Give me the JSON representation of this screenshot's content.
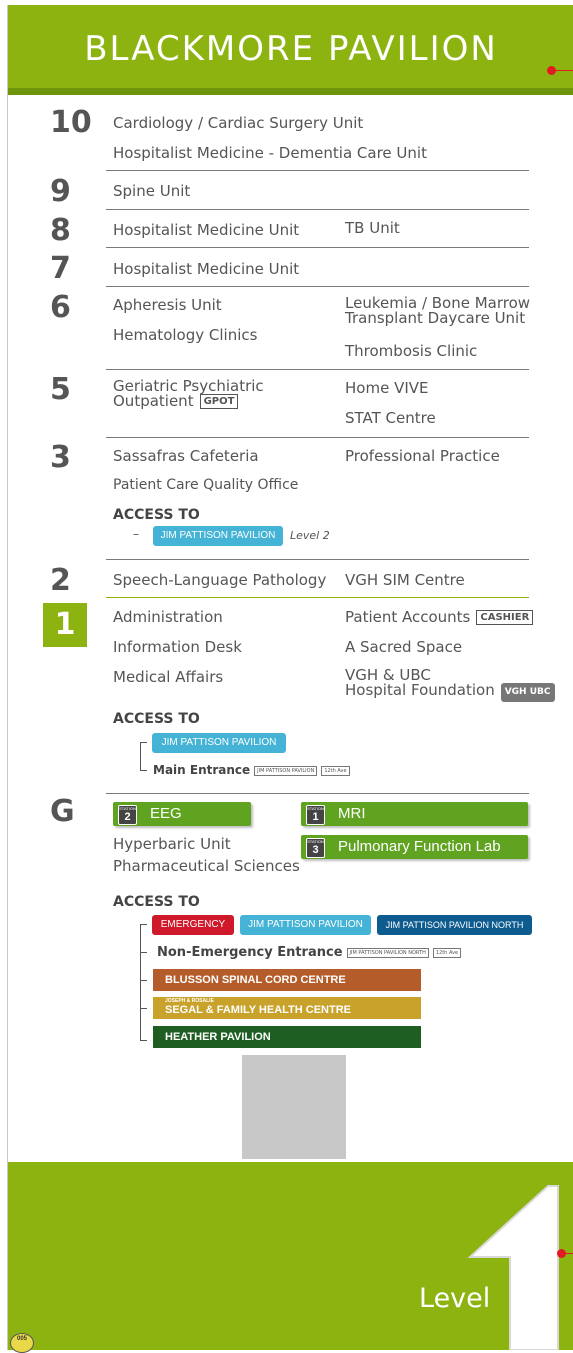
{
  "header": {
    "title": "BLACKMORE PAVILION"
  },
  "floors": {
    "f10": {
      "num": "10",
      "a": "Cardiology / Cardiac Surgery Unit",
      "b": "Hospitalist Medicine - Dementia Care Unit"
    },
    "f9": {
      "num": "9",
      "a": "Spine Unit"
    },
    "f8": {
      "num": "8",
      "a": "Hospitalist Medicine Unit",
      "b": "TB Unit"
    },
    "f7": {
      "num": "7",
      "a": "Hospitalist Medicine Unit"
    },
    "f6": {
      "num": "6",
      "a": "Apheresis Unit",
      "b": "Hematology Clinics",
      "c1": "Leukemia / Bone Marrow",
      "c2": "Transplant Daycare Unit",
      "d": "Thrombosis Clinic"
    },
    "f5": {
      "num": "5",
      "a1": "Geriatric Psychiatric",
      "a2": "Outpatient",
      "badge": "GPOT",
      "b": "Home VIVE",
      "c": "STAT Centre"
    },
    "f3": {
      "num": "3",
      "a": "Sassafras Cafeteria",
      "b": "Patient Care Quality Office",
      "c": "Professional Practice",
      "access_heading": "ACCESS TO",
      "dash": "–",
      "pill": "JIM PATTISON PAVILION",
      "level_note": "Level 2"
    },
    "f2": {
      "num": "2",
      "a": "Speech-Language Pathology",
      "b": "VGH SIM Centre"
    },
    "f1": {
      "num": "1",
      "a": "Administration",
      "b": "Information Desk",
      "c": "Medical Affairs",
      "d": "Patient Accounts",
      "d_badge": "CASHIER",
      "e": "A Sacred Space",
      "f1": "VGH & UBC",
      "f2": "Hospital Foundation",
      "foundation_logo": "VGH UBC",
      "access_heading": "ACCESS TO",
      "pill": "JIM PATTISON PAVILION",
      "main_entrance": "Main Entrance",
      "mini1": "JIM PATTISON PAVILION",
      "mini2": "12th Ave"
    },
    "fG": {
      "num": "G",
      "s2": {
        "station": "STATION",
        "n": "2",
        "label": "EEG"
      },
      "s1": {
        "station": "STATION",
        "n": "1",
        "label": "MRI"
      },
      "s3": {
        "station": "STATION",
        "n": "3",
        "label": "Pulmonary Function Lab"
      },
      "a": "Hyperbaric Unit",
      "b": "Pharmaceutical Sciences",
      "access_heading": "ACCESS TO",
      "emergency": "EMERGENCY",
      "jpp": "JIM PATTISON PAVILION",
      "jppn": "JIM PATTISON PAVILION NORTH",
      "non_emergency": "Non-Emergency Entrance",
      "mini1": "JIM PATTISON PAVILION NORTH",
      "mini2": "12th Ave",
      "blusson": "BLUSSON SPINAL CORD CENTRE",
      "segal_small": "JOSEPH & ROSALIE",
      "segal": "SEGAL & FAMILY HEALTH CENTRE",
      "heather": "HEATHER PAVILION"
    }
  },
  "footer": {
    "level_label": "Level",
    "big_number": "1",
    "tag_number": "005",
    "tag_small": "005"
  },
  "colors": {
    "green": "#8cb30f",
    "station_green": "#5fa320",
    "teal": "#45b3d6",
    "red": "#d0182b",
    "navy": "#0e5c8f",
    "brown": "#b45d2b",
    "mustard": "#c8a22a",
    "dark_green": "#1e5e22"
  }
}
